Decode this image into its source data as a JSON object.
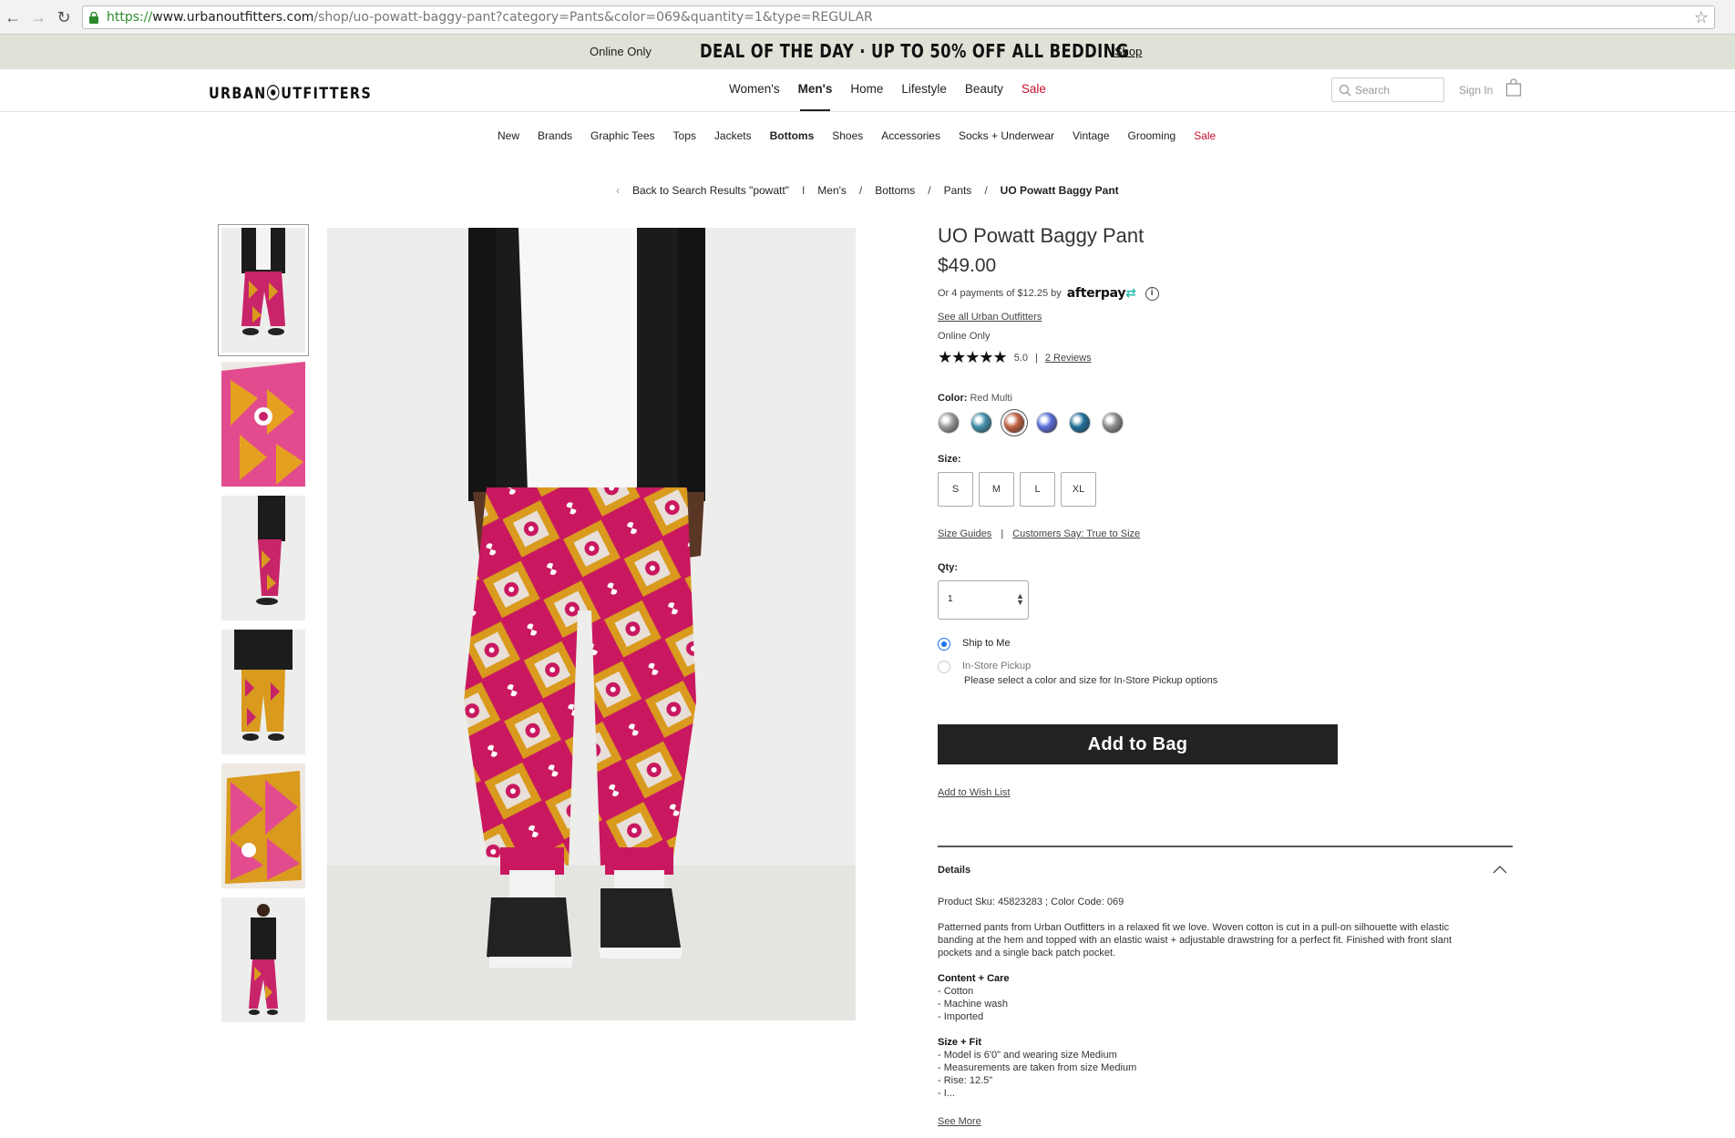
{
  "browser": {
    "url_scheme": "https://",
    "url_host": "www.urbanoutfitters.com",
    "url_path": "/shop/uo-powatt-baggy-pant?category=Pants&color=069&quantity=1&type=REGULAR"
  },
  "promo": {
    "online_only": "Online Only",
    "deal": "DEAL OF THE DAY · UP TO 50% OFF ALL BEDDING",
    "shop": "Shop"
  },
  "header": {
    "logo": "URBAN⦿UTFITTERS",
    "nav": [
      {
        "label": "Women's"
      },
      {
        "label": "Men's"
      },
      {
        "label": "Home"
      },
      {
        "label": "Lifestyle"
      },
      {
        "label": "Beauty"
      },
      {
        "label": "Sale"
      }
    ],
    "search_placeholder": "Search",
    "sign_in": "Sign In"
  },
  "subnav": [
    {
      "label": "New"
    },
    {
      "label": "Brands"
    },
    {
      "label": "Graphic Tees"
    },
    {
      "label": "Tops"
    },
    {
      "label": "Jackets"
    },
    {
      "label": "Bottoms"
    },
    {
      "label": "Shoes"
    },
    {
      "label": "Accessories"
    },
    {
      "label": "Socks + Underwear"
    },
    {
      "label": "Vintage"
    },
    {
      "label": "Grooming"
    },
    {
      "label": "Sale"
    }
  ],
  "breadcrumb": {
    "back": "Back to Search Results \"powatt\"",
    "divider": "I",
    "items": [
      "Men's",
      "Bottoms",
      "Pants",
      "UO Powatt Baggy Pant"
    ]
  },
  "product": {
    "title": "UO Powatt Baggy Pant",
    "price": "$49.00",
    "afterpay_text": "Or 4 payments of $12.25 by",
    "afterpay_brand": "afterpay",
    "see_all": "See all Urban Outfitters",
    "online_only": "Online Only",
    "rating_value": "5.0",
    "rating_stars": "★★★★★",
    "reviews": "2 Reviews",
    "color_label": "Color:",
    "color_value": "Red Multi",
    "swatch_colors": [
      "#9a9a9a",
      "#3f8fa8",
      "#c06040",
      "#5a6cd8",
      "#1f6f9a",
      "#8c8c8c"
    ],
    "size_label": "Size:",
    "sizes": [
      "S",
      "M",
      "L",
      "XL"
    ],
    "size_guides": "Size Guides",
    "customers_say": "Customers Say: True to Size",
    "qty_label": "Qty:",
    "qty_value": "1",
    "ship_to_me": "Ship to Me",
    "in_store": "In-Store Pickup",
    "pickup_note": "Please select a color and size for In-Store Pickup options",
    "add_to_bag": "Add to Bag",
    "wishlist": "Add to Wish List"
  },
  "details": {
    "heading": "Details",
    "sku": "Product Sku: 45823283 ; Color Code: 069",
    "description": "Patterned pants from Urban Outfitters in a relaxed fit we love. Woven cotton is cut in a pull-on silhouette with elastic banding at the hem and topped with an elastic waist + adjustable drawstring for a perfect fit. Finished with front slant pockets and a single back patch pocket.",
    "content_heading": "Content + Care",
    "content_items": [
      "- Cotton",
      "- Machine wash",
      "- Imported"
    ],
    "fit_heading": "Size + Fit",
    "fit_items": [
      "- Model is 6'0\" and wearing size Medium",
      "- Measurements are taken from size Medium",
      "- Rise: 12.5\"",
      "- I..."
    ],
    "see_more": "See More"
  }
}
